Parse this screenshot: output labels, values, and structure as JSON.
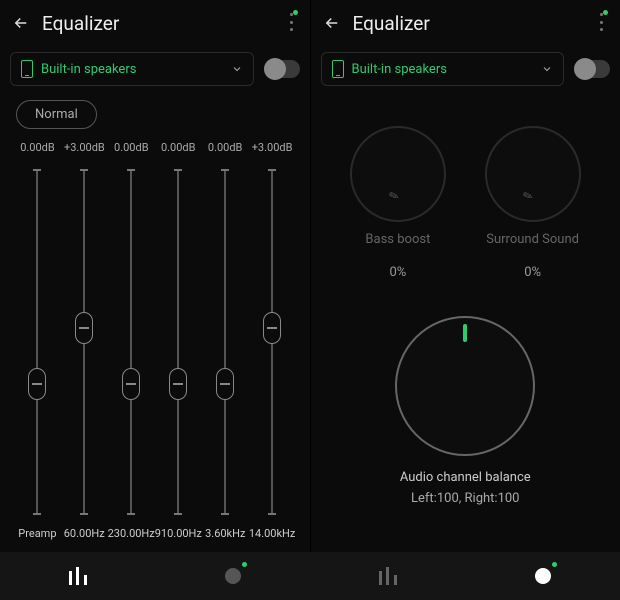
{
  "colors": {
    "accent": "#2ecc71"
  },
  "left": {
    "header": {
      "title": "Equalizer"
    },
    "device": {
      "label": "Built-in speakers"
    },
    "preset": "Normal",
    "bands": [
      {
        "db": "0.00dB",
        "freq": "Preamp",
        "pos": 62
      },
      {
        "db": "+3.00dB",
        "freq": "60.00Hz",
        "pos": 46
      },
      {
        "db": "0.00dB",
        "freq": "230.00Hz",
        "pos": 62
      },
      {
        "db": "0.00dB",
        "freq": "910.00Hz",
        "pos": 62
      },
      {
        "db": "0.00dB",
        "freq": "3.60kHz",
        "pos": 62
      },
      {
        "db": "+3.00dB",
        "freq": "14.00kHz",
        "pos": 46
      }
    ]
  },
  "right": {
    "header": {
      "title": "Equalizer"
    },
    "device": {
      "label": "Built-in speakers"
    },
    "bass": {
      "label": "Bass boost",
      "value": "0%"
    },
    "surround": {
      "label": "Surround Sound",
      "value": "0%"
    },
    "balance": {
      "label": "Audio channel balance",
      "value": "Left:100, Right:100"
    }
  },
  "nav": {
    "items": [
      "eq-sliders",
      "balance-disabled",
      "eq-sliders-disabled",
      "balance-active"
    ]
  }
}
